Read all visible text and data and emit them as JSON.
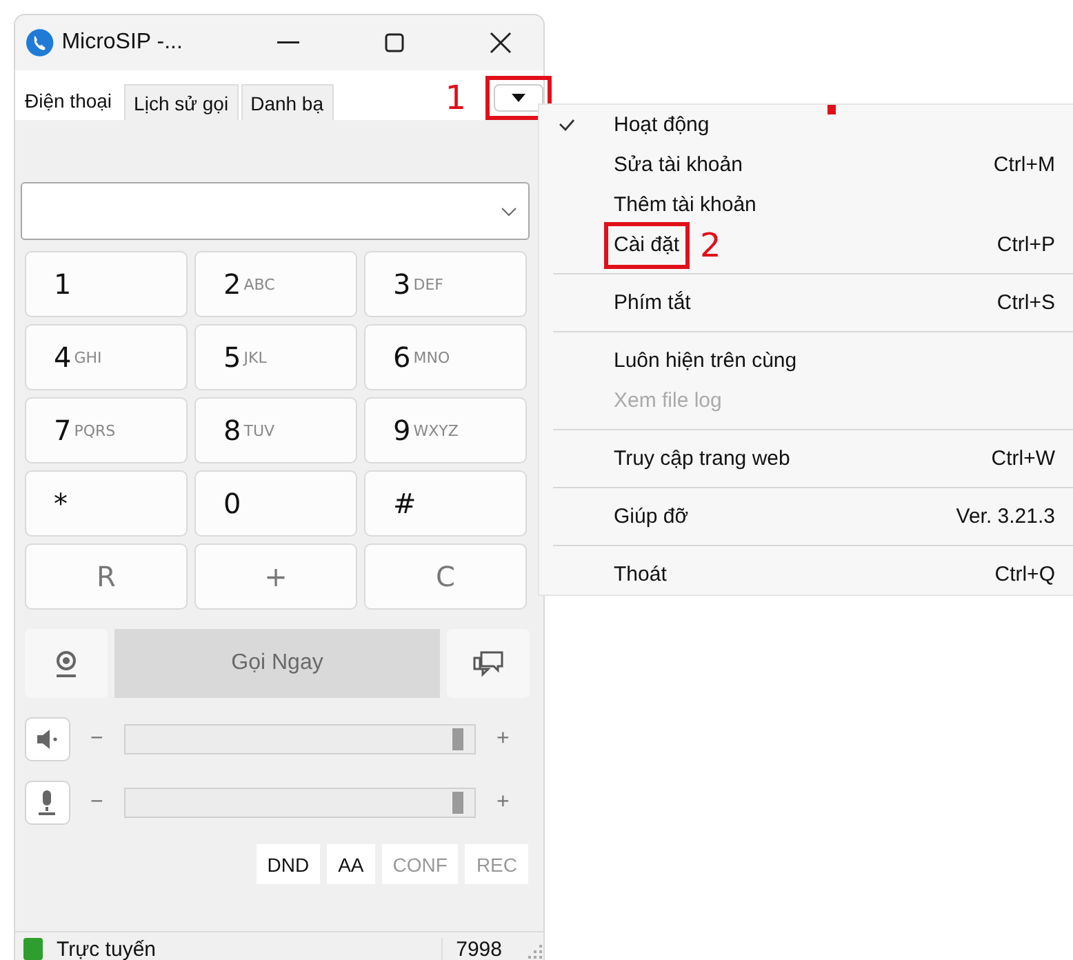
{
  "window": {
    "title": "MicroSIP -..."
  },
  "tabs": [
    {
      "label": "Điện thoại",
      "selected": true
    },
    {
      "label": "Lịch sử gọi",
      "selected": false
    },
    {
      "label": "Danh bạ",
      "selected": false
    }
  ],
  "menu_button": {
    "annotation": "1"
  },
  "keypad": [
    {
      "kind": "digit",
      "digit": "1"
    },
    {
      "kind": "digit",
      "digit": "2",
      "letters": "ABC"
    },
    {
      "kind": "digit",
      "digit": "3",
      "letters": "DEF"
    },
    {
      "kind": "digit",
      "digit": "4",
      "letters": "GHI"
    },
    {
      "kind": "digit",
      "digit": "5",
      "letters": "JKL"
    },
    {
      "kind": "digit",
      "digit": "6",
      "letters": "MNO"
    },
    {
      "kind": "digit",
      "digit": "7",
      "letters": "PQRS"
    },
    {
      "kind": "digit",
      "digit": "8",
      "letters": "TUV"
    },
    {
      "kind": "digit",
      "digit": "9",
      "letters": "WXYZ"
    },
    {
      "kind": "digit",
      "digit": "*"
    },
    {
      "kind": "digit",
      "digit": "0"
    },
    {
      "kind": "digit",
      "digit": "#"
    },
    {
      "kind": "action",
      "digit": "R"
    },
    {
      "kind": "action",
      "digit": "+"
    },
    {
      "kind": "action",
      "digit": "C"
    }
  ],
  "call_button": {
    "label": "Gọi Ngay",
    "disabled": true
  },
  "volume": [
    {
      "kind": "speaker",
      "minus": "−",
      "plus": "+",
      "level": 0.97
    },
    {
      "kind": "microphone",
      "minus": "−",
      "plus": "+",
      "level": 0.97
    }
  ],
  "toggles": [
    {
      "label": "DND",
      "disabled": false
    },
    {
      "label": "AA",
      "disabled": false
    },
    {
      "label": "CONF",
      "disabled": true
    },
    {
      "label": "REC",
      "disabled": true
    }
  ],
  "status_bar": {
    "status": "Trực tuyến",
    "number": "7998"
  },
  "menu": [
    [
      {
        "label": "Hoạt động",
        "checked": true,
        "disabled": false
      },
      {
        "label": "Sửa tài khoản",
        "shortcut": "Ctrl+M",
        "checked": false,
        "disabled": false
      },
      {
        "label": "Thêm tài khoản",
        "checked": false,
        "disabled": false
      },
      {
        "label": "Cài đặt",
        "shortcut": "Ctrl+P",
        "checked": false,
        "disabled": false,
        "annotation": "2"
      }
    ],
    [
      {
        "label": "Phím tắt",
        "shortcut": "Ctrl+S",
        "checked": false,
        "disabled": false
      }
    ],
    [
      {
        "label": "Luôn hiện trên cùng",
        "checked": false,
        "disabled": false
      },
      {
        "label": "Xem file log",
        "checked": false,
        "disabled": true
      }
    ],
    [
      {
        "label": "Truy cập trang web",
        "shortcut": "Ctrl+W",
        "checked": false,
        "disabled": false
      }
    ],
    [
      {
        "label": "Giúp đỡ",
        "shortcut": "Ver. 3.21.3",
        "checked": false,
        "disabled": false
      }
    ],
    [
      {
        "label": "Thoát",
        "shortcut": "Ctrl+Q",
        "checked": false,
        "disabled": false
      }
    ]
  ]
}
